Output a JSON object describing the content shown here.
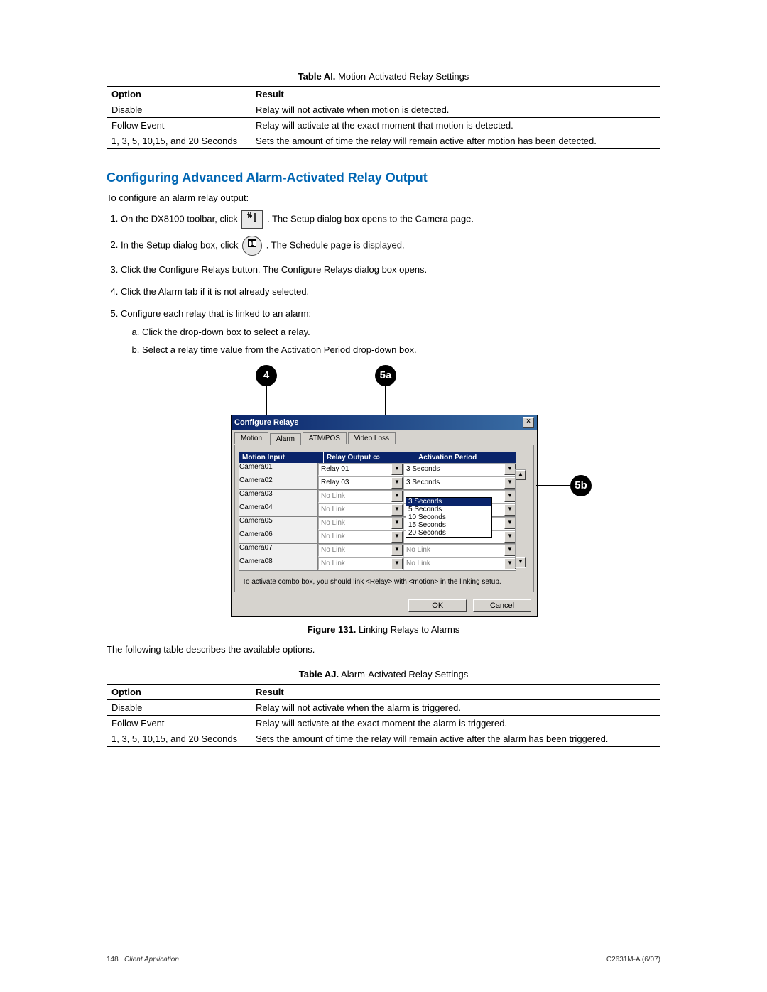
{
  "table_ai": {
    "caption_prefix": "Table AI.",
    "caption_text": "Motion-Activated Relay Settings",
    "headers": {
      "option": "Option",
      "result": "Result"
    },
    "rows": [
      {
        "option": "Disable",
        "result": "Relay will not activate when motion is detected."
      },
      {
        "option": "Follow Event",
        "result": "Relay will activate at the exact moment that motion is detected."
      },
      {
        "option": "1, 3, 5, 10,15, and 20 Seconds",
        "result": "Sets the amount of time the relay will remain active after motion has been detected."
      }
    ]
  },
  "section_heading": "Configuring Advanced Alarm-Activated Relay Output",
  "intro": "To configure an alarm relay output:",
  "steps": {
    "s1_a": "On the DX8100 toolbar, click ",
    "s1_b": ". The Setup dialog box opens to the Camera page.",
    "s2_a": "In the Setup dialog box, click ",
    "s2_b": ". The Schedule page is displayed.",
    "s3": "Click the Configure Relays button. The Configure Relays dialog box opens.",
    "s4": "Click the Alarm tab if it is not already selected.",
    "s5": "Configure each relay that is linked to an alarm:",
    "s5a": "Click the drop-down box to select a relay.",
    "s5b": "Select a relay time value from the Activation Period drop-down box."
  },
  "callouts": {
    "c4": "4",
    "c5a": "5a",
    "c5b": "5b"
  },
  "dialog": {
    "title": "Configure Relays",
    "tabs": [
      "Motion",
      "Alarm",
      "ATM/POS",
      "Video Loss"
    ],
    "active_tab_index": 1,
    "columns": {
      "motion": "Motion Input",
      "relay": "Relay Output",
      "activation": "Activation Period"
    },
    "rows": [
      {
        "cam": "Camera01",
        "relay": "Relay 01",
        "activation": "3 Seconds",
        "nolink": false
      },
      {
        "cam": "Camera02",
        "relay": "Relay 03",
        "activation": "3 Seconds",
        "nolink": false
      },
      {
        "cam": "Camera03",
        "relay": "No Link",
        "activation": "",
        "nolink": true
      },
      {
        "cam": "Camera04",
        "relay": "No Link",
        "activation": "",
        "nolink": true
      },
      {
        "cam": "Camera05",
        "relay": "No Link",
        "activation": "",
        "nolink": true
      },
      {
        "cam": "Camera06",
        "relay": "No Link",
        "activation": "No Link",
        "nolink": true
      },
      {
        "cam": "Camera07",
        "relay": "No Link",
        "activation": "No Link",
        "nolink": true
      },
      {
        "cam": "Camera08",
        "relay": "No Link",
        "activation": "No Link",
        "nolink": true
      }
    ],
    "dropdown_options": [
      "3 Seconds",
      "5 Seconds",
      "10 Seconds",
      "15 Seconds",
      "20 Seconds"
    ],
    "hint": "To activate combo box, you should link <Relay> with <motion> in the linking setup.",
    "ok": "OK",
    "cancel": "Cancel"
  },
  "figure": {
    "prefix": "Figure 131.",
    "text": "Linking Relays to Alarms"
  },
  "after_figure": "The following table describes the available options.",
  "table_aj": {
    "caption_prefix": "Table AJ.",
    "caption_text": "Alarm-Activated Relay Settings",
    "headers": {
      "option": "Option",
      "result": "Result"
    },
    "rows": [
      {
        "option": "Disable",
        "result": "Relay will not activate when the alarm is triggered."
      },
      {
        "option": "Follow Event",
        "result": "Relay will activate at the exact moment the alarm is triggered."
      },
      {
        "option": "1, 3, 5, 10,15, and 20 Seconds",
        "result": "Sets the amount of time the relay will remain active after the alarm has been triggered."
      }
    ]
  },
  "footer": {
    "page": "148",
    "section": "Client Application",
    "doc": "C2631M-A (6/07)"
  }
}
